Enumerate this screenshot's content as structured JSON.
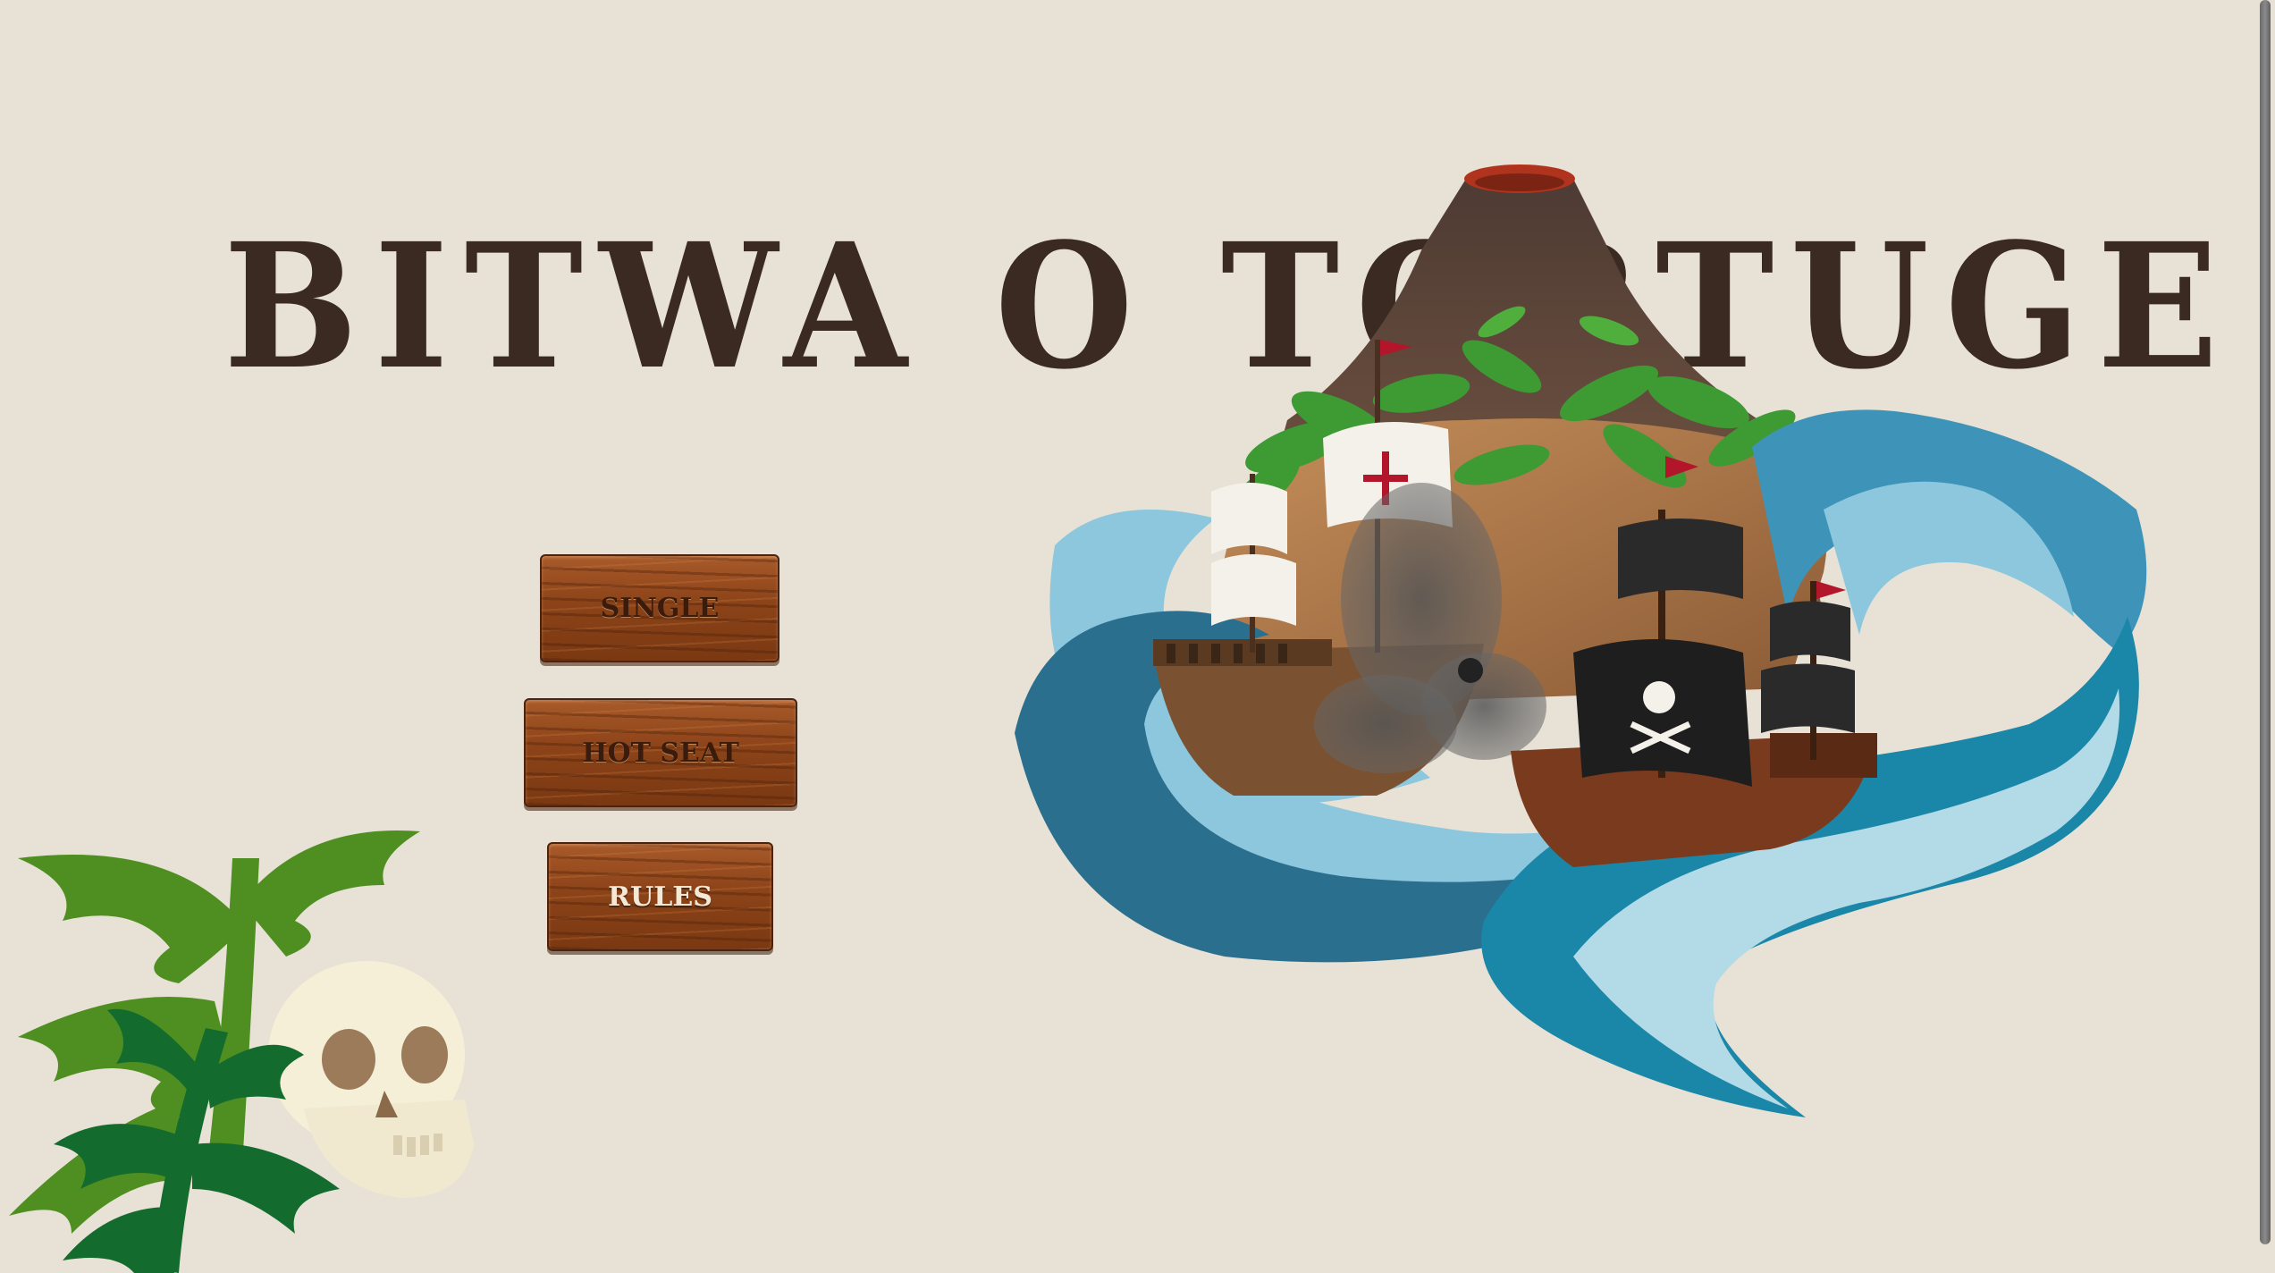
{
  "game": {
    "title": "BITWA O TORTUGE"
  },
  "menu": {
    "single_label": "SINGLE",
    "hotseat_label": "HOT SEAT",
    "rules_label": "RULES"
  },
  "colors": {
    "background": "#e8e2d6",
    "title": "#3a2a22",
    "wood": "#8c4318",
    "sea_dark": "#1f7ea3",
    "sea_light": "#8cc7dd",
    "leaf_green": "#4f8f22"
  }
}
